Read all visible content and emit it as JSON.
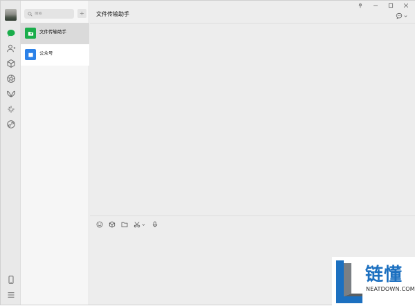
{
  "sidebar": {
    "icons": [
      "chat-icon",
      "contacts-icon",
      "box-icon",
      "aperture-icon",
      "butterfly-icon",
      "sparkle-icon",
      "link-icon",
      "phone-icon",
      "menu-icon"
    ]
  },
  "search": {
    "placeholder": "搜索"
  },
  "chats": [
    {
      "title": "文件传输助手",
      "icon": "folder-icon",
      "color": "#1aad4b"
    },
    {
      "title": "公众号",
      "icon": "bookmark-icon",
      "color": "#2c82e8"
    }
  ],
  "header": {
    "title": "文件传输助手"
  },
  "toolbar": {
    "tools": [
      "emoji-icon",
      "sticker-box-icon",
      "folder-icon",
      "scissors-icon",
      "microphone-icon"
    ]
  },
  "watermark": {
    "brand_cn": "链懂",
    "brand_en": "NEATDOWN.COM"
  },
  "colors": {
    "accent_green": "#1aad4b",
    "accent_blue": "#2c82e8",
    "watermark_blue": "#1c70c0"
  }
}
